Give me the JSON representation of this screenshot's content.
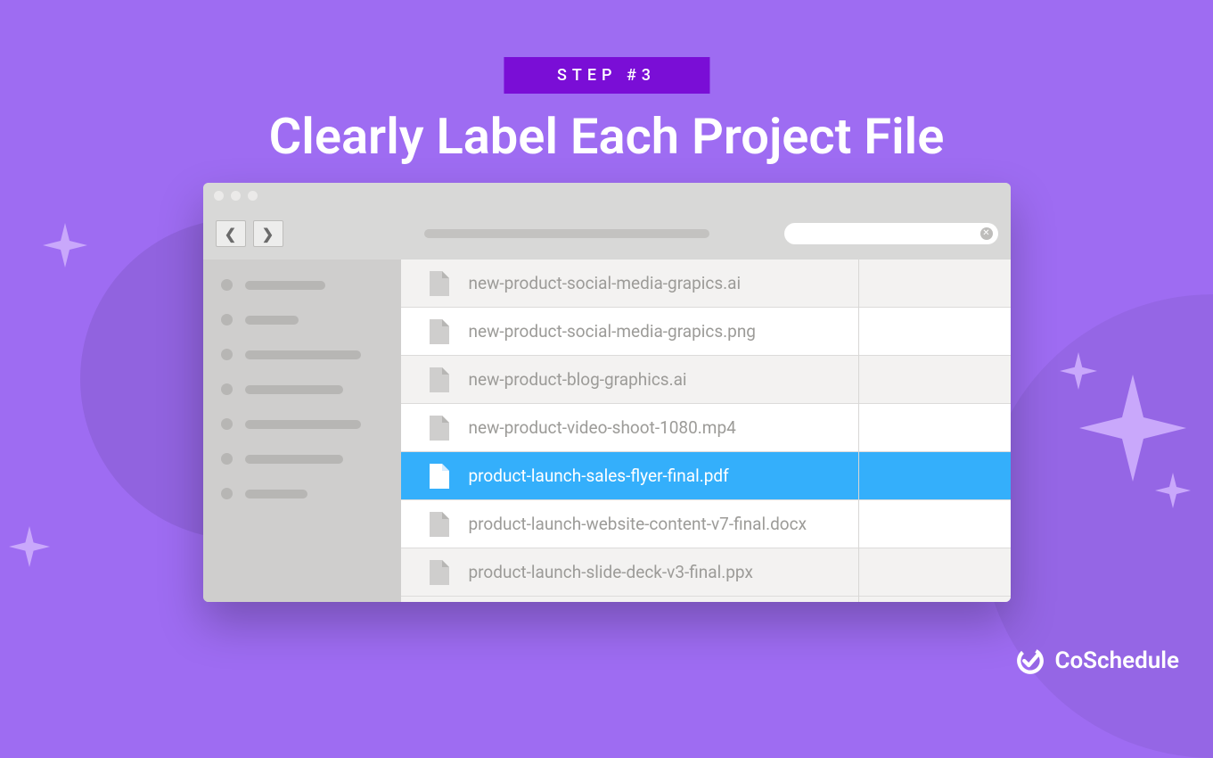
{
  "badge_label": "STEP #3",
  "title": "Clearly Label Each Project File",
  "files": [
    {
      "name": "new-product-social-media-grapics.ai"
    },
    {
      "name": "new-product-social-media-grapics.png"
    },
    {
      "name": "new-product-blog-graphics.ai"
    },
    {
      "name": "new-product-video-shoot-1080.mp4"
    },
    {
      "name": "product-launch-sales-flyer-final.pdf"
    },
    {
      "name": "product-launch-website-content-v7-final.docx"
    },
    {
      "name": "product-launch-slide-deck-v3-final.ppx"
    }
  ],
  "selected_index": 4,
  "brand_name": "CoSchedule"
}
